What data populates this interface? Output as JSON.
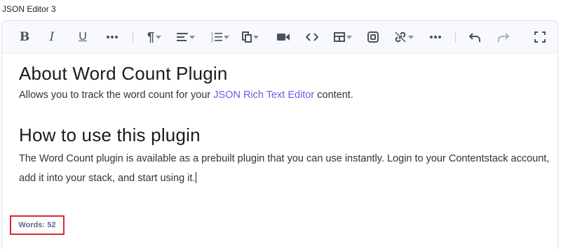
{
  "field": {
    "label": "JSON Editor 3"
  },
  "toolbar": {
    "buttons": [
      {
        "icon": "bold-icon",
        "glyph": "B"
      },
      {
        "icon": "italic-icon",
        "glyph": "I"
      },
      {
        "icon": "underline-icon",
        "glyph": "U"
      },
      {
        "icon": "more-formatting-icon"
      },
      {
        "icon": "paragraph-icon"
      },
      {
        "icon": "align-icon"
      },
      {
        "icon": "list-icon"
      },
      {
        "icon": "copy-icon"
      },
      {
        "icon": "video-icon"
      },
      {
        "icon": "code-icon"
      },
      {
        "icon": "table-icon"
      },
      {
        "icon": "embed-icon"
      },
      {
        "icon": "link-icon"
      },
      {
        "icon": "more-icon"
      },
      {
        "icon": "undo-icon"
      },
      {
        "icon": "redo-icon"
      },
      {
        "icon": "fullscreen-icon"
      }
    ]
  },
  "content": {
    "heading1": "About Word Count Plugin",
    "para1_before": "Allows you to track the word count for your ",
    "para1_link": "JSON Rich Text Editor",
    "para1_after": " content.",
    "heading2": "How to use this plugin",
    "para2": "The Word Count plugin is available as a prebuilt plugin that you can use instantly. Login to your Contentstack account, add it into your stack, and start using it."
  },
  "footer": {
    "word_count": "Words: 52"
  },
  "colors": {
    "link": "#6c5ce7",
    "highlight_border": "#e02424",
    "toolbar_bg": "#f7f9fc"
  }
}
